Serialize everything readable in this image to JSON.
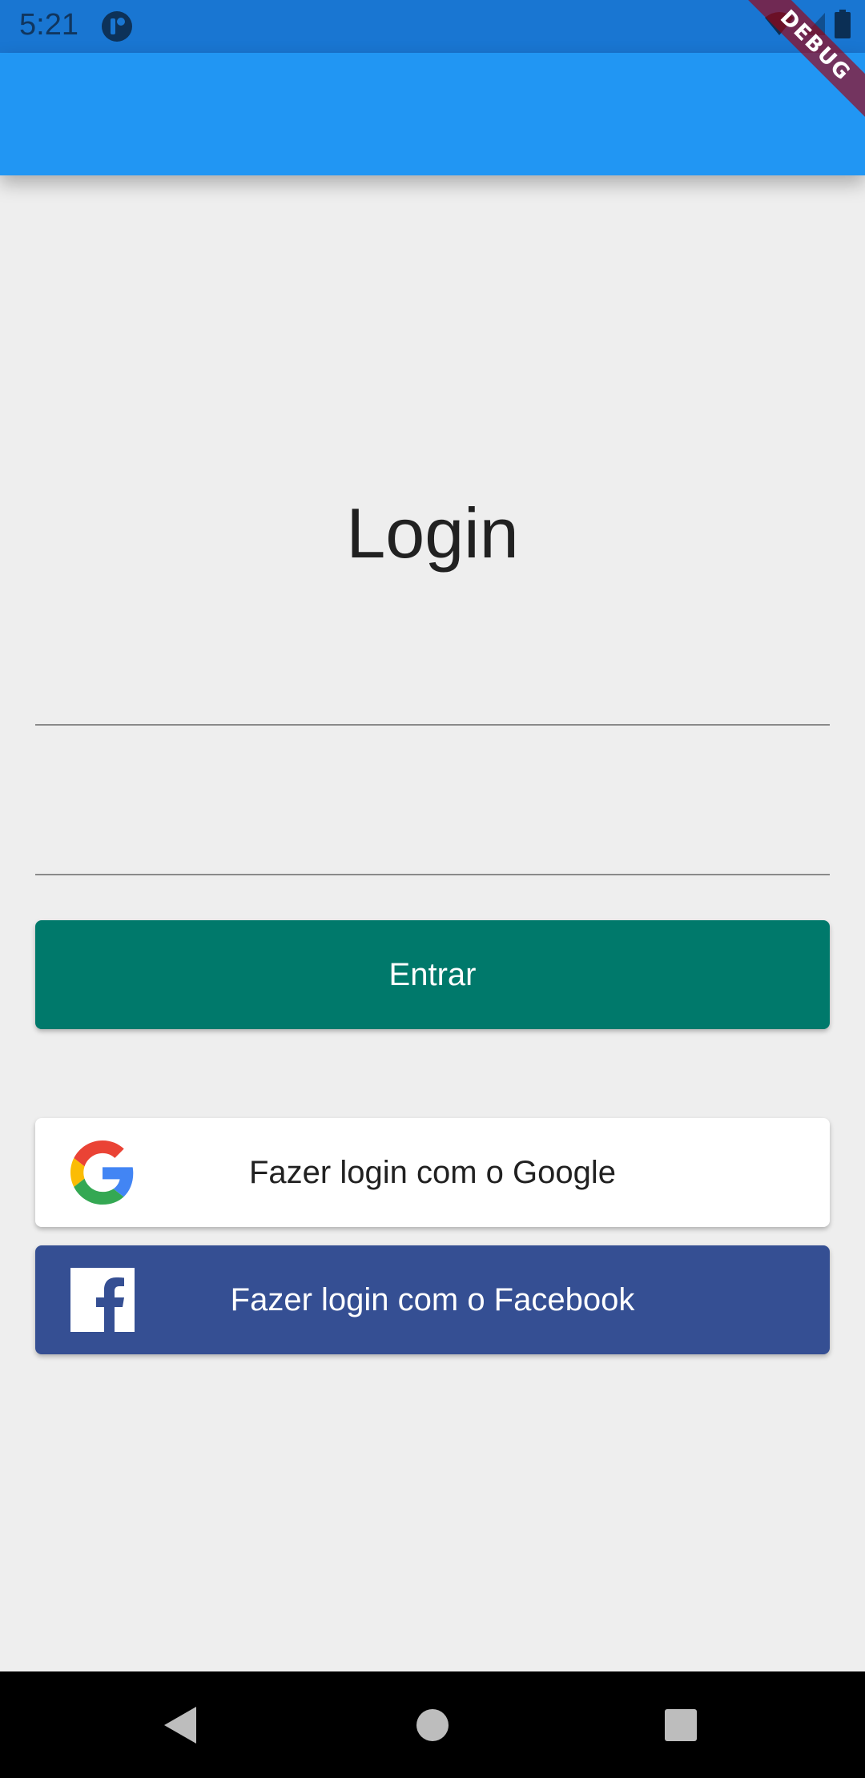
{
  "status_bar": {
    "time": "5:21",
    "icons": [
      "app-notification-icon",
      "wifi-icon",
      "signal-icon",
      "battery-icon"
    ]
  },
  "debug_banner": "DEBUG",
  "colors": {
    "status_bar": "#1976d2",
    "app_bar": "#2196f3",
    "background": "#eeeeee",
    "entrar_button": "#00796b",
    "google_button": "#ffffff",
    "facebook_button": "#354f93"
  },
  "login": {
    "title": "Login",
    "username_value": "",
    "password_value": "",
    "entrar_label": "Entrar",
    "google_label": "Fazer login com o Google",
    "facebook_label": "Fazer login com o Facebook"
  },
  "nav_bar": {
    "buttons": [
      "back-icon",
      "home-icon",
      "recent-apps-icon"
    ]
  }
}
